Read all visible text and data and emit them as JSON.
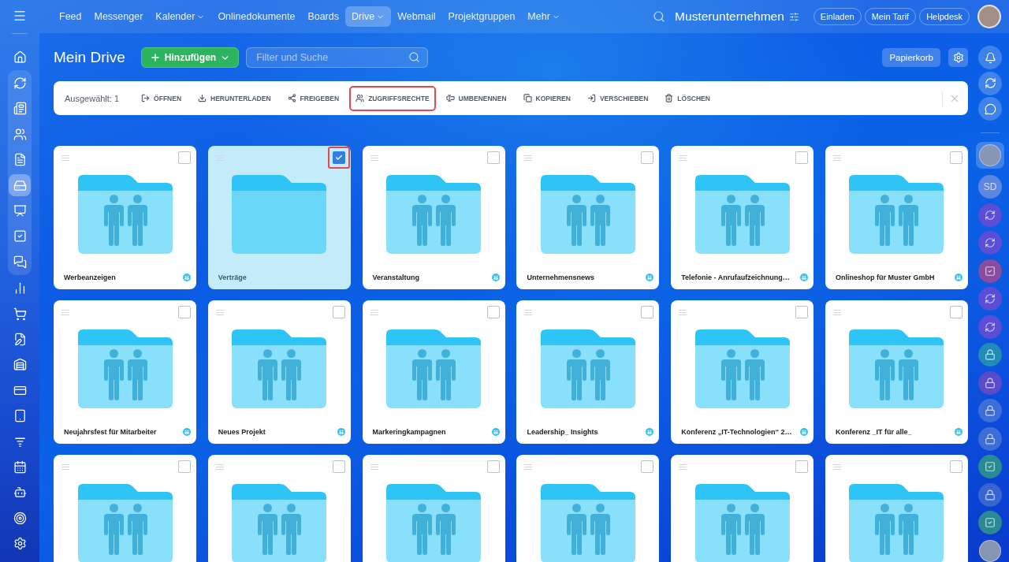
{
  "sidebar": {
    "top": [
      {
        "kind": "home",
        "selected": false
      }
    ],
    "pinned": [
      {
        "kind": "pulse",
        "selected": false
      },
      {
        "kind": "news",
        "selected": false
      },
      {
        "kind": "contacts",
        "selected": false
      },
      {
        "kind": "document",
        "selected": false
      },
      {
        "kind": "drive",
        "selected": true
      },
      {
        "kind": "board",
        "selected": false
      },
      {
        "kind": "tasks",
        "selected": false
      },
      {
        "kind": "chats",
        "selected": false
      }
    ],
    "more": [
      {
        "kind": "analytics",
        "selected": false
      },
      {
        "kind": "cart",
        "selected": false
      },
      {
        "kind": "sign",
        "selected": false
      },
      {
        "kind": "warehouse",
        "selected": false
      },
      {
        "kind": "card",
        "selected": false
      },
      {
        "kind": "device",
        "selected": false
      },
      {
        "kind": "funnel",
        "selected": false
      },
      {
        "kind": "calendar",
        "selected": false
      },
      {
        "kind": "robot",
        "selected": false
      },
      {
        "kind": "target",
        "selected": false
      },
      {
        "kind": "settings",
        "selected": false
      }
    ]
  },
  "nav": {
    "items": [
      {
        "label": "Feed",
        "selected": false,
        "dropdown": false
      },
      {
        "label": "Messenger",
        "selected": false,
        "dropdown": false
      },
      {
        "label": "Kalender",
        "selected": false,
        "dropdown": true
      },
      {
        "label": "Onlinedokumente",
        "selected": false,
        "dropdown": false
      },
      {
        "label": "Boards",
        "selected": false,
        "dropdown": false
      },
      {
        "label": "Drive",
        "selected": true,
        "dropdown": true
      },
      {
        "label": "Webmail",
        "selected": false,
        "dropdown": false
      },
      {
        "label": "Projektgruppen",
        "selected": false,
        "dropdown": false
      },
      {
        "label": "Mehr",
        "selected": false,
        "dropdown": true
      }
    ]
  },
  "header": {
    "company": "Musterunternehmen",
    "buttons": [
      "Einladen",
      "Mein Tarif",
      "Helpdesk"
    ]
  },
  "page": {
    "title": "Mein Drive",
    "add_button": "Hinzufügen",
    "search": {
      "placeholder": "Filter und Suche"
    },
    "trash_button": "Papierkorb"
  },
  "toolbar": {
    "selection": "Ausgewählt: 1",
    "actions": [
      {
        "kind": "open",
        "label": "ÖFFNEN",
        "highlighted": false
      },
      {
        "kind": "download",
        "label": "HERUNTERLADEN",
        "highlighted": false
      },
      {
        "kind": "share",
        "label": "FREIGEBEN",
        "highlighted": false
      },
      {
        "kind": "access",
        "label": "ZUGRIFFSRECHTE",
        "highlighted": true
      },
      {
        "kind": "rename",
        "label": "UMBENENNEN",
        "highlighted": false
      },
      {
        "kind": "copy",
        "label": "KOPIEREN",
        "highlighted": false
      },
      {
        "kind": "move",
        "label": "VERSCHIEBEN",
        "highlighted": false
      },
      {
        "kind": "delete",
        "label": "LÖSCHEN",
        "highlighted": false
      }
    ]
  },
  "folders": [
    {
      "name": "Werbeanzeigen",
      "shared": true,
      "selected": false,
      "highlighted": false
    },
    {
      "name": "Verträge",
      "shared": false,
      "selected": true,
      "highlighted": true
    },
    {
      "name": "Veranstaltung",
      "shared": true,
      "selected": false,
      "highlighted": false
    },
    {
      "name": "Unternehmensnews",
      "shared": true,
      "selected": false,
      "highlighted": false
    },
    {
      "name": "Telefonie - Anrufaufzeichnung…",
      "shared": true,
      "selected": false,
      "highlighted": false
    },
    {
      "name": "Onlineshop für Muster GmbH",
      "shared": true,
      "selected": false,
      "highlighted": false
    },
    {
      "name": "Neujahrsfest für Mitarbeiter",
      "shared": true,
      "selected": false,
      "highlighted": false
    },
    {
      "name": "Neues Projekt",
      "shared": true,
      "selected": false,
      "highlighted": false
    },
    {
      "name": "Markeringkampagnen",
      "shared": true,
      "selected": false,
      "highlighted": false
    },
    {
      "name": "Leadership_ Insights",
      "shared": true,
      "selected": false,
      "highlighted": false
    },
    {
      "name": "Konferenz „IT-Technologien“ 2…",
      "shared": true,
      "selected": false,
      "highlighted": false
    },
    {
      "name": "Konferenz _IT für alle_",
      "shared": true,
      "selected": false,
      "highlighted": false
    },
    {
      "shared": true,
      "selected": false,
      "highlighted": false
    },
    {
      "shared": true,
      "selected": false,
      "highlighted": false
    },
    {
      "shared": true,
      "selected": false,
      "highlighted": false
    },
    {
      "shared": true,
      "selected": false,
      "highlighted": false
    },
    {
      "shared": true,
      "selected": false,
      "highlighted": false
    },
    {
      "shared": true,
      "selected": false,
      "highlighted": false
    }
  ],
  "right_rail": {
    "tools": [
      {
        "kind": "bell"
      },
      {
        "kind": "openlines"
      },
      {
        "kind": "chat"
      }
    ],
    "chats": [
      {
        "kind": "photo",
        "selected": true
      },
      {
        "kind": "initials",
        "initials": "SD",
        "color": "#5c86e0",
        "selected": false
      },
      {
        "kind": "openlines",
        "color": "#5a4ed6",
        "selected": false
      },
      {
        "kind": "openlines",
        "color": "#5a4ed6",
        "selected": false
      },
      {
        "kind": "task",
        "color": "#8a4c9e",
        "selected": false
      },
      {
        "kind": "openlines",
        "color": "#5a4ed6",
        "selected": false
      },
      {
        "kind": "openlines",
        "color": "#5a4ed6",
        "selected": false
      },
      {
        "kind": "lock",
        "color": "#1f8cb8",
        "selected": false
      },
      {
        "kind": "lock",
        "color": "#5a4cc8",
        "selected": false
      },
      {
        "kind": "lock",
        "color": "#3d6ed8",
        "selected": false
      },
      {
        "kind": "lock",
        "color": "#3d6ed8",
        "selected": false
      },
      {
        "kind": "task",
        "color": "#2a8a94",
        "selected": false
      },
      {
        "kind": "lock",
        "color": "#3766d0",
        "selected": false
      },
      {
        "kind": "task",
        "color": "#2a8a94",
        "selected": false
      },
      {
        "kind": "photo",
        "selected": false
      }
    ]
  }
}
